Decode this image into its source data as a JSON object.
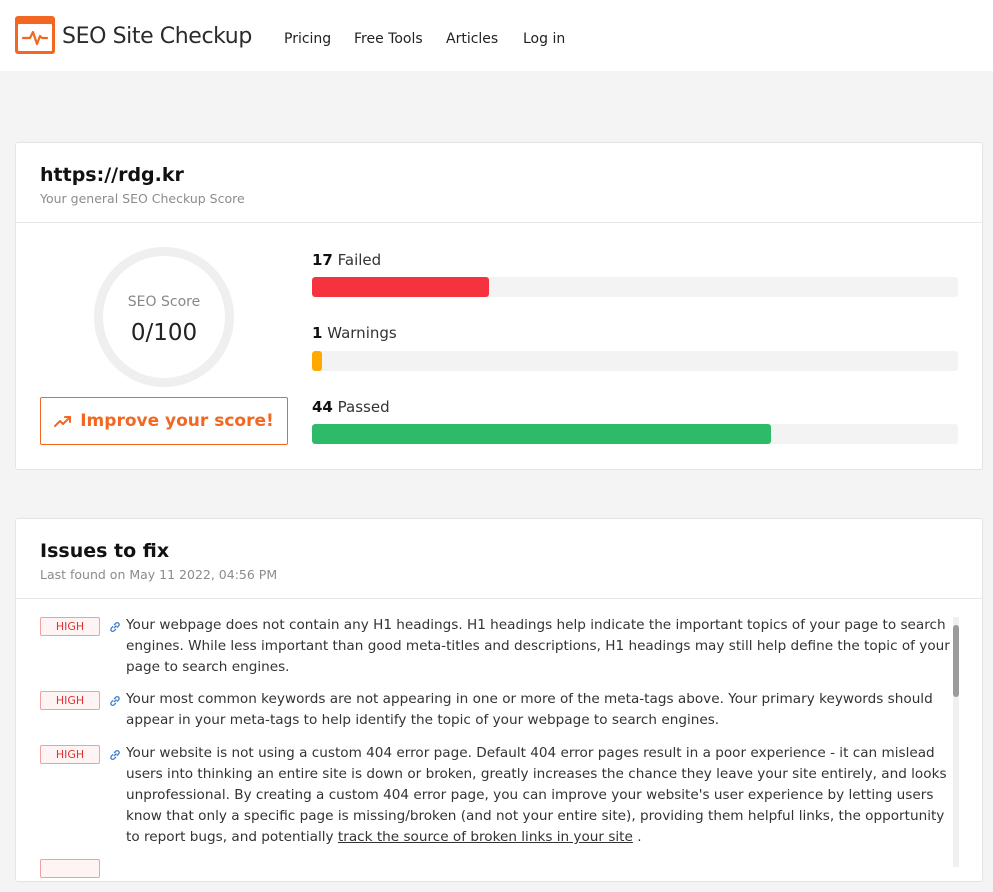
{
  "brand": {
    "name": "SEO Site Checkup",
    "color": "#f26722"
  },
  "nav": [
    "Pricing",
    "Free Tools",
    "Articles",
    "Log in"
  ],
  "score_card": {
    "url": "https://rdg.kr",
    "subtitle": "Your general SEO Checkup Score",
    "score_label": "SEO Score",
    "score_value": "0/100",
    "improve_label": "Improve your score!",
    "stats": [
      {
        "count": "17",
        "label": "Failed",
        "color": "#f5333f",
        "fraction": 0.274
      },
      {
        "count": "1",
        "label": "Warnings",
        "color": "#ffa800",
        "fraction": 0.016
      },
      {
        "count": "44",
        "label": "Passed",
        "color": "#2dbb6a",
        "fraction": 0.71
      }
    ]
  },
  "issues_card": {
    "title": "Issues to fix",
    "last_found": "Last found on May 11 2022, 04:56 PM",
    "issues": [
      {
        "severity": "HIGH",
        "text": "Your webpage does not contain any H1 headings. H1 headings help indicate the important topics of your page to search engines. While less important than good meta-titles and descriptions, H1 headings may still help define the topic of your page to search engines."
      },
      {
        "severity": "HIGH",
        "text": "Your most common keywords are not appearing in one or more of the meta-tags above. Your primary keywords should appear in your meta-tags to help identify the topic of your webpage to search engines."
      },
      {
        "severity": "HIGH",
        "text_before": "Your website is not using a custom 404 error page. Default 404 error pages result in a poor experience - it can mislead users into thinking an entire site is down or broken, greatly increases the chance they leave your site entirely, and looks unprofessional. By creating a custom 404 error page, you can improve your website's user experience by letting users know that only a specific page is missing/broken (and not your entire site), providing them helpful links, the opportunity to report bugs, and potentially",
        "link_text": "track the source of broken links in your site",
        "text_after": " ."
      }
    ]
  }
}
